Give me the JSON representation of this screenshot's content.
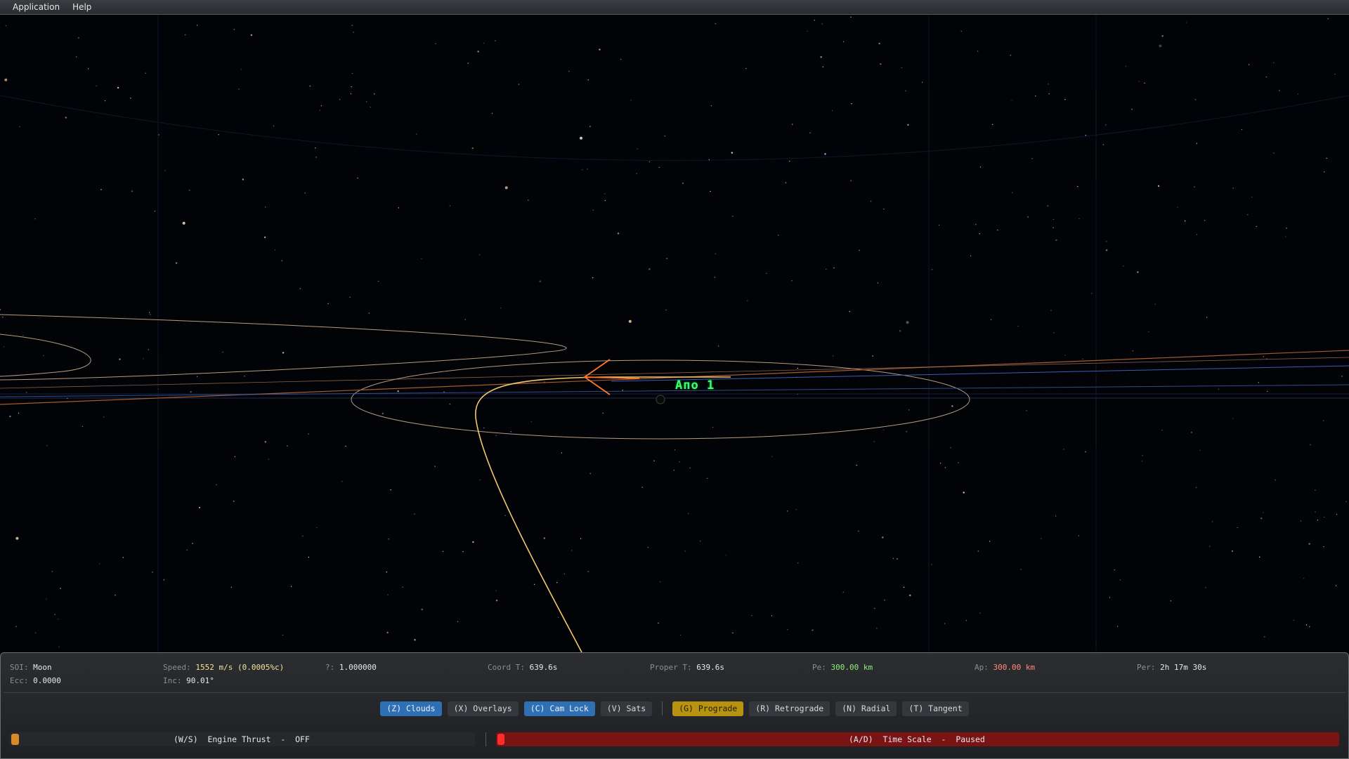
{
  "menu": {
    "items": [
      "Application",
      "Help"
    ]
  },
  "craft": {
    "label": "Апо 1"
  },
  "stats": {
    "soi": {
      "key": "SOI:",
      "value": "Moon"
    },
    "ecc": {
      "key": "Ecc:",
      "value": "0.0000"
    },
    "speed": {
      "key": "Speed:",
      "value": "1552 m/s (0.0005%c)"
    },
    "inc": {
      "key": "Inc:",
      "value": "90.01°"
    },
    "gamma": {
      "key": "?:",
      "value": "1.000000"
    },
    "coord": {
      "key": "Coord T:",
      "value": "639.6s"
    },
    "proper": {
      "key": "Proper T:",
      "value": "639.6s"
    },
    "pe": {
      "key": "Pe:",
      "value": "300.00 km"
    },
    "ap": {
      "key": "Ap:",
      "value": "300.00 km"
    },
    "per": {
      "key": "Per:",
      "value": "2h 17m 30s"
    }
  },
  "toggles": [
    {
      "label": "(Z) Clouds",
      "state": "on"
    },
    {
      "label": "(X) Overlays",
      "state": "off"
    },
    {
      "label": "(C) Cam Lock",
      "state": "on"
    },
    {
      "label": "(V) Sats",
      "state": "off"
    }
  ],
  "directions": [
    {
      "label": "(G) Prograde",
      "state": "on"
    },
    {
      "label": "(R) Retrograde",
      "state": "off"
    },
    {
      "label": "(N) Radial",
      "state": "off"
    },
    {
      "label": "(T) Tangent",
      "state": "off"
    }
  ],
  "thrust": {
    "label": "(W/S)  Engine Thrust  -  OFF",
    "level": 0.0
  },
  "timescale": {
    "label": "(A/D)  Time Scale  -  Paused",
    "level": 0.0
  },
  "colors": {
    "accent_blue": "#2f6fb3",
    "accent_gold": "#b8930f",
    "thrust": "#d88a2a",
    "timescale": "#ff2d2d",
    "trajectory": "#f5c86a",
    "craft_label": "#3cff6e"
  }
}
